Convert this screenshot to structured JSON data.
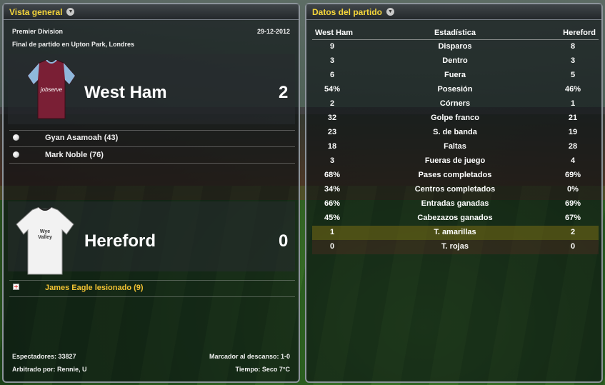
{
  "left_panel": {
    "title": "Vista general",
    "competition": "Premier Division",
    "date": "29-12-2012",
    "venue": "Final de partido en Upton Park, Londres",
    "home": {
      "name": "West Ham",
      "score": "2",
      "kit_color": "#7a1f35",
      "kit_sleeve_color": "#8fb8dc",
      "sponsor": "jobserve",
      "events": [
        {
          "icon": "goal-ball-icon",
          "text": "Gyan Asamoah (43)"
        },
        {
          "icon": "goal-ball-icon",
          "text": "Mark Noble (76)"
        }
      ]
    },
    "away": {
      "name": "Hereford",
      "score": "0",
      "kit_color": "#f2f2f2",
      "sponsor": "Wye Valley",
      "events": [
        {
          "icon": "injury-icon",
          "text": "James Eagle lesionado (9)"
        }
      ]
    },
    "footer": {
      "attendance": "Espectadores: 33827",
      "referee": "Arbitrado por: Rennie, U",
      "half_time": "Marcador al descanso: 1-0",
      "weather": "Tiempo: Seco 7°C"
    }
  },
  "right_panel": {
    "title": "Datos del partido",
    "headers": {
      "home": "West Ham",
      "stat": "Estadística",
      "away": "Hereford"
    },
    "rows": [
      {
        "home": "9",
        "stat": "Disparos",
        "away": "8"
      },
      {
        "home": "3",
        "stat": "Dentro",
        "away": "3"
      },
      {
        "home": "6",
        "stat": "Fuera",
        "away": "5"
      },
      {
        "home": "54%",
        "stat": "Posesión",
        "away": "46%"
      },
      {
        "home": "2",
        "stat": "Córners",
        "away": "1"
      },
      {
        "home": "32",
        "stat": "Golpe franco",
        "away": "21"
      },
      {
        "home": "23",
        "stat": "S. de banda",
        "away": "19"
      },
      {
        "home": "18",
        "stat": "Faltas",
        "away": "28"
      },
      {
        "home": "3",
        "stat": "Fueras de juego",
        "away": "4"
      },
      {
        "home": "68%",
        "stat": "Pases completados",
        "away": "69%"
      },
      {
        "home": "34%",
        "stat": "Centros completados",
        "away": "0%"
      },
      {
        "home": "66%",
        "stat": "Entradas ganadas",
        "away": "69%"
      },
      {
        "home": "45%",
        "stat": "Cabezazos ganados",
        "away": "67%"
      },
      {
        "home": "1",
        "stat": "T. amarillas",
        "away": "2"
      },
      {
        "home": "0",
        "stat": "T. rojas",
        "away": "0"
      }
    ]
  },
  "colors": {
    "title_yellow": "#f5d53a",
    "injury_text": "#f2c233"
  }
}
